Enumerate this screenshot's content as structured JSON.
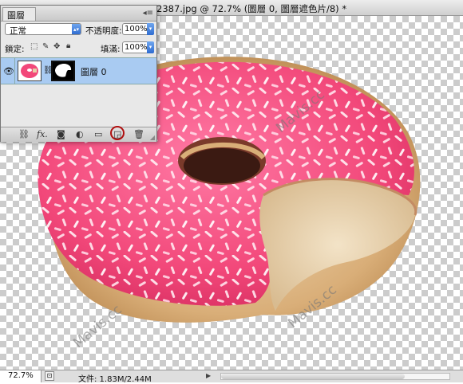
{
  "document": {
    "title": "2387.jpg @ 72.7% (圖層 0, 圖層遮色片/8) *"
  },
  "watermark": {
    "text": "Mavis.cc"
  },
  "layers_panel": {
    "tab_label": "圖層",
    "menu_icon": "panel-menu-icon",
    "blend_mode": "正常",
    "opacity_label": "不透明度:",
    "opacity_value": "100%",
    "lock_label": "鎖定:",
    "fill_label": "填滿:",
    "fill_value": "100%",
    "layer": {
      "name": "圖層 0",
      "selected": true
    },
    "bottom_icons": [
      "link-layers-icon",
      "fx-icon",
      "add-mask-icon",
      "adjustment-layer-icon",
      "new-group-icon",
      "new-layer-icon",
      "trash-icon"
    ],
    "fx_label": "fx.",
    "highlight_color": "#b01010",
    "selection_color": "#a9cbf2"
  },
  "status_bar": {
    "zoom": "72.7%",
    "doc_size": "文件: 1.83M/2.44M"
  }
}
